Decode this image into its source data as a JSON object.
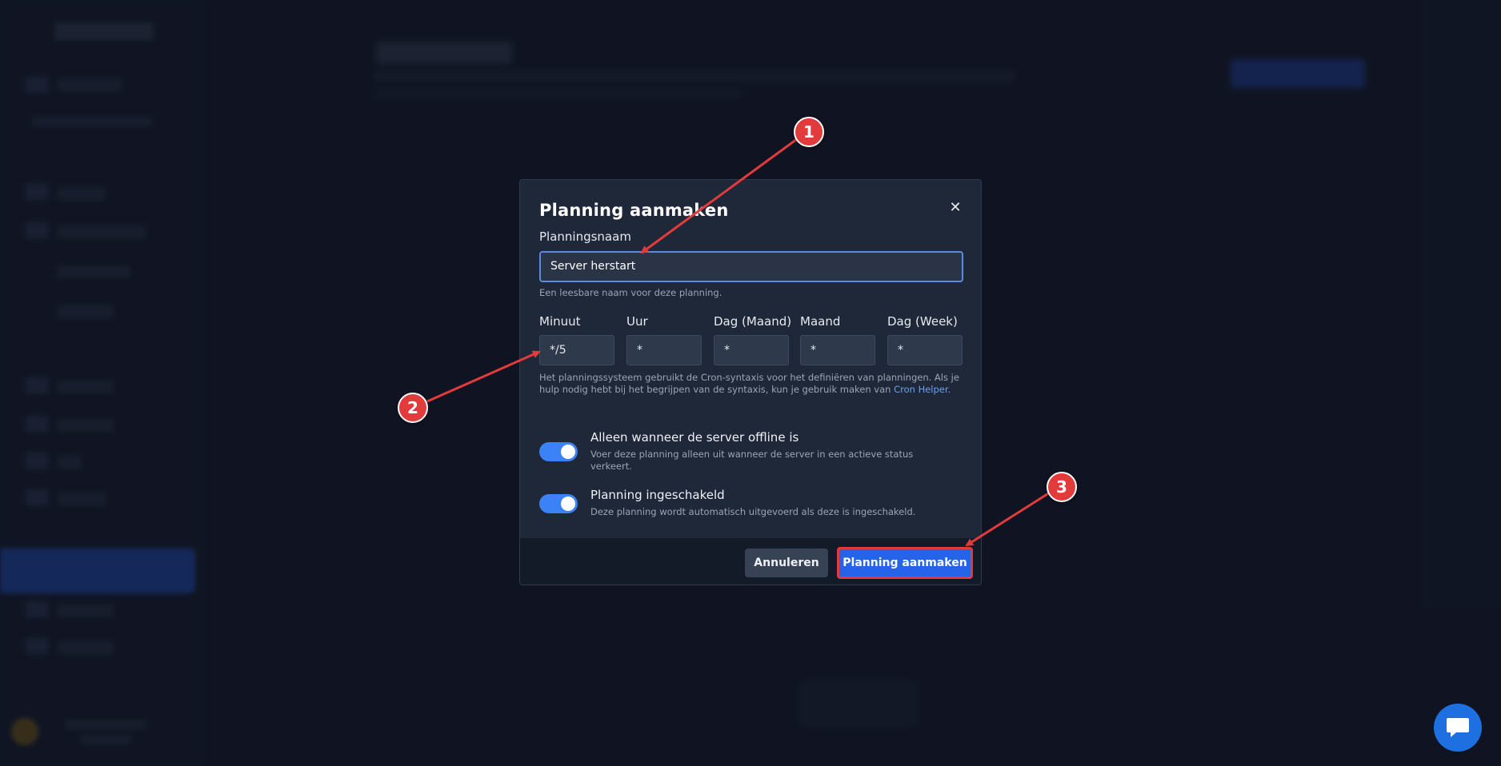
{
  "modal": {
    "title": "Planning aanmaken",
    "close_icon": "close-icon",
    "name_label": "Planningsnaam",
    "name_value": "Server herstart",
    "name_help": "Een leesbare naam voor deze planning.",
    "cron": {
      "labels": [
        "Minuut",
        "Uur",
        "Dag (Maand)",
        "Maand",
        "Dag (Week)"
      ],
      "values": [
        "*/5",
        "*",
        "*",
        "*",
        "*"
      ]
    },
    "cron_help_text": "Het planningssysteem gebruikt de Cron-syntaxis voor het definiëren van planningen. Als je hulp nodig hebt bij het begrijpen van de syntaxis, kun je gebruik maken van",
    "cron_help_link": "Cron Helper",
    "cron_help_end": ".",
    "toggle_offline": {
      "title": "Alleen wanneer de server offline is",
      "description": "Voer deze planning alleen uit wanneer de server in een actieve status verkeert.",
      "checked": true
    },
    "toggle_enabled": {
      "title": "Planning ingeschakeld",
      "description": "Deze planning wordt automatisch uitgevoerd als deze is ingeschakeld.",
      "checked": true
    },
    "cancel_label": "Annuleren",
    "create_label": "Planning aanmaken"
  },
  "annotations": {
    "badge_1": "1",
    "badge_2": "2",
    "badge_3": "3",
    "color": "#e23b3b"
  },
  "chat": {
    "icon": "chat-icon"
  },
  "colors": {
    "accent": "#2563eb",
    "toggle_on": "#3b82f6",
    "link": "#6aa2f5"
  }
}
